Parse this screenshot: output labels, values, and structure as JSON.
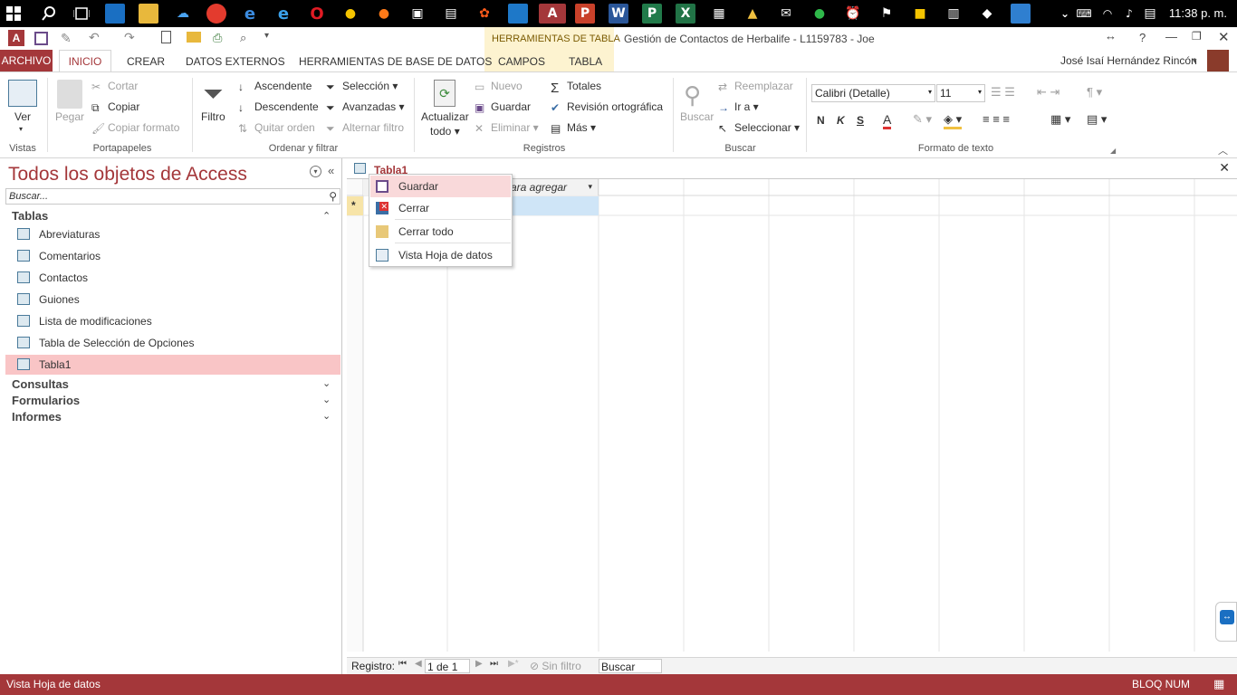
{
  "taskbar": {
    "time": "11:38 p. m."
  },
  "window": {
    "title": "Gestión de Contactos de Herbalife - L1159783 - Joe",
    "context_group": "HERRAMIENTAS DE TABLA",
    "help": "?",
    "user": "José Isaí Hernández Rincón"
  },
  "tabs": {
    "archivo": "ARCHIVO",
    "inicio": "INICIO",
    "crear": "CREAR",
    "datos_externos": "DATOS EXTERNOS",
    "herramientas_bd": "HERRAMIENTAS DE BASE DE DATOS",
    "campos": "CAMPOS",
    "tabla": "TABLA"
  },
  "ribbon": {
    "vistas": {
      "ver": "Ver",
      "label": "Vistas"
    },
    "portapapeles": {
      "pegar": "Pegar",
      "cortar": "Cortar",
      "copiar": "Copiar",
      "copiar_formato": "Copiar formato",
      "label": "Portapapeles"
    },
    "ordenar": {
      "filtro": "Filtro",
      "ascendente": "Ascendente",
      "descendente": "Descendente",
      "quitar_orden": "Quitar orden",
      "seleccion": "Selección",
      "avanzadas": "Avanzadas",
      "alternar_filtro": "Alternar filtro",
      "label": "Ordenar y filtrar"
    },
    "registros": {
      "actualizar": "Actualizar",
      "todo": "todo",
      "nuevo": "Nuevo",
      "guardar": "Guardar",
      "eliminar": "Eliminar",
      "totales": "Totales",
      "revision": "Revisión ortográfica",
      "mas": "Más",
      "label": "Registros"
    },
    "buscar": {
      "buscar": "Buscar",
      "reemplazar": "Reemplazar",
      "ir_a": "Ir a",
      "seleccionar": "Seleccionar",
      "label": "Buscar"
    },
    "formato": {
      "font": "Calibri (Detalle)",
      "size": "11",
      "bold": "N",
      "italic": "K",
      "underline": "S",
      "label": "Formato de texto"
    }
  },
  "nav": {
    "title": "Todos los objetos de Access",
    "search_placeholder": "Buscar...",
    "sections": {
      "tablas": "Tablas",
      "consultas": "Consultas",
      "formularios": "Formularios",
      "informes": "Informes"
    },
    "tables": [
      "Abreviaturas",
      "Comentarios",
      "Contactos",
      "Guiones",
      "Lista de modificaciones",
      "Tabla de Selección de Opciones",
      "Tabla1"
    ]
  },
  "document": {
    "tab": "Tabla1",
    "column_header": "ara agregar"
  },
  "context_menu": {
    "items": [
      "Guardar",
      "Cerrar",
      "Cerrar todo",
      "Vista Hoja de datos"
    ]
  },
  "record_nav": {
    "label": "Registro:",
    "position": "1 de 1",
    "filter": "Sin filtro",
    "search": "Buscar"
  },
  "status": {
    "left": "Vista Hoja de datos",
    "right": "BLOQ NUM"
  },
  "colors": {
    "accent": "#a4373a",
    "selection": "#f9c5c6",
    "context": "#fdf3d0"
  }
}
